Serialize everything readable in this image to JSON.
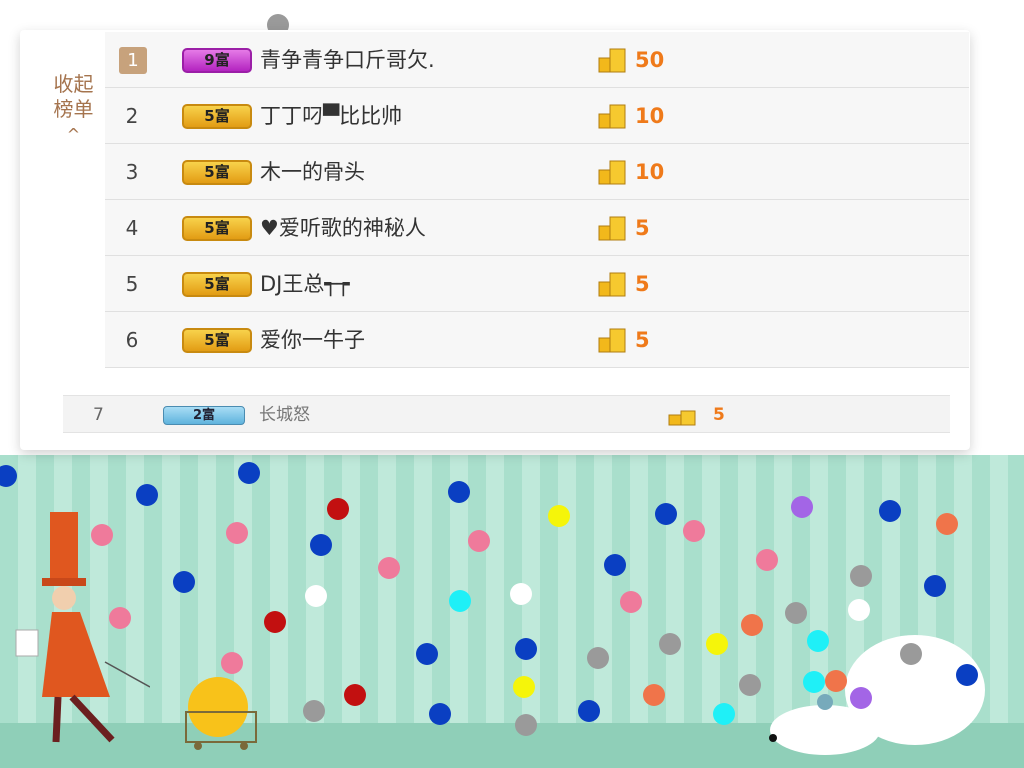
{
  "panel": {
    "collapse_label": "收起\n榜单",
    "collapse_arrow": "^",
    "rows": [
      {
        "rank": "1",
        "badge": "9富",
        "name": "青争青争口斤哥欠.",
        "amount": "50"
      },
      {
        "rank": "2",
        "badge": "5富",
        "name": "丁丁叼▀比比帅",
        "amount": "10"
      },
      {
        "rank": "3",
        "badge": "5富",
        "name": "木一的骨头",
        "amount": "10"
      },
      {
        "rank": "4",
        "badge": "5富",
        "name": "♥爱听歌的神秘人",
        "amount": "5"
      },
      {
        "rank": "5",
        "badge": "5富",
        "name": "DJ王总┭┮",
        "amount": "5"
      },
      {
        "rank": "6",
        "badge": "5富",
        "name": "爱你一牛子",
        "amount": "5"
      }
    ],
    "row7": {
      "rank": "7",
      "badge": "2富",
      "name": "长城怒",
      "amount": "5"
    }
  },
  "colors": {
    "gray": "#9a9a9a",
    "purple": "#a365e6",
    "blue": "#0a3fc2",
    "pink": "#ef7a9b",
    "red": "#c21010",
    "white": "#ffffff",
    "cyan": "#1ff0f7",
    "yellow": "#f5f50a",
    "orange": "#f0744a"
  }
}
